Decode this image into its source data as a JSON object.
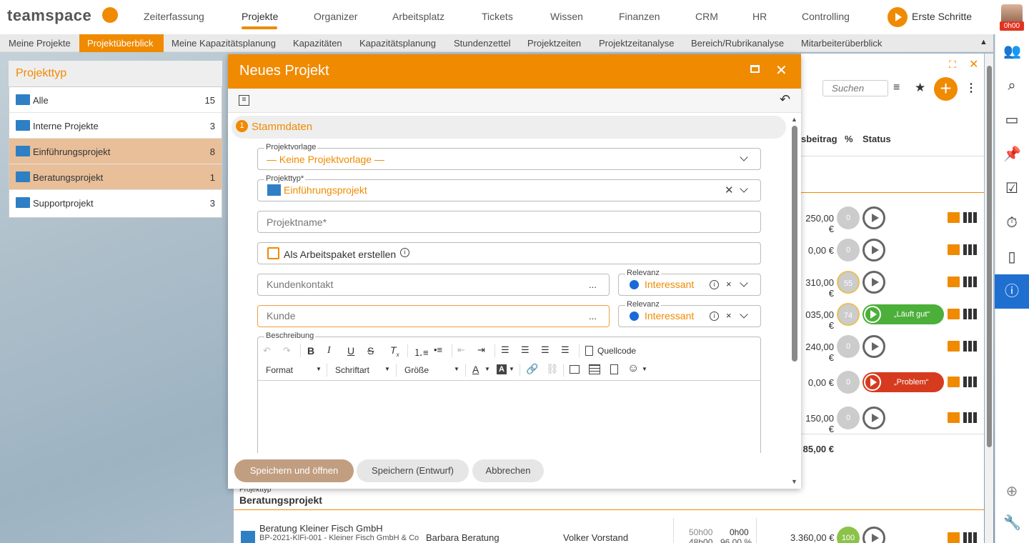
{
  "app": {
    "logo": "teamspace",
    "timer": "0h00",
    "erste": "Erste Schritte"
  },
  "nav": [
    "Zeiterfassung",
    "Projekte",
    "Organizer",
    "Arbeitsplatz",
    "Tickets",
    "Wissen",
    "Finanzen",
    "CRM",
    "HR",
    "Controlling"
  ],
  "subnav": [
    "Meine Projekte",
    "Projektüberblick",
    "Meine Kapazitätsplanung",
    "Kapazitäten",
    "Kapazitätsplanung",
    "Stundenzettel",
    "Projektzeiten",
    "Projektzeitanalyse",
    "Bereich/Rubrikanalyse",
    "Mitarbeiterüberblick"
  ],
  "left": {
    "title": "Projekttyp",
    "items": [
      {
        "label": "Alle",
        "count": "15"
      },
      {
        "label": "Interne Projekte",
        "count": "3"
      },
      {
        "label": "Einführungsprojekt",
        "count": "8"
      },
      {
        "label": "Beratungsprojekt",
        "count": "1"
      },
      {
        "label": "Supportprojekt",
        "count": "3"
      }
    ]
  },
  "bg": {
    "search_placeholder": "Suchen",
    "col_beitrag": "sbeitrag",
    "col_pct": "%",
    "col_status": "Status",
    "rows": [
      {
        "amount": "250,00 €",
        "score": "0"
      },
      {
        "amount": "0,00 €",
        "score": "0"
      },
      {
        "amount": "310,00 €",
        "score": "55"
      },
      {
        "amount": "035,00 €",
        "score": "74",
        "pill": "„Läuft gut“"
      },
      {
        "amount": "240,00 €",
        "score": "0"
      },
      {
        "amount": "0,00 €",
        "score": "0",
        "pill": "„Problem“"
      },
      {
        "amount": "150,00 €",
        "score": "0"
      }
    ],
    "total": "85,00 €",
    "group_label": "Projekttyp",
    "group_value": "Beratungsprojekt",
    "last_row": {
      "name": "Beratung Kleiner Fisch GmbH",
      "sub": "BP-2021-KlFi-001 - Kleiner Fisch GmbH & Co",
      "person1": "Barbara Beratung",
      "person2": "Volker Vorstand",
      "h1": "50h00",
      "h2": "0h00",
      "h3": "48h00",
      "h4": "96,00 %",
      "amount": "3.360,00 €",
      "score": "100"
    }
  },
  "modal": {
    "title": "Neues Projekt",
    "section": "Stammdaten",
    "section_num": "1",
    "vorlage_label": "Projektvorlage",
    "vorlage_value": "— Keine Projektvorlage —",
    "typ_label": "Projekttyp*",
    "typ_value": "Einführungsprojekt",
    "name_placeholder": "Projektname*",
    "arbeitspaket": "Als Arbeitspaket erstellen",
    "kontakt_placeholder": "Kundenkontakt",
    "kunde_placeholder": "Kunde",
    "dots": "...",
    "relevanz_label": "Relevanz",
    "relevanz_value": "Interessant",
    "beschreibung_label": "Beschreibung",
    "editor": {
      "quellcode": "Quellcode",
      "format": "Format",
      "schriftart": "Schriftart",
      "groesse": "Größe"
    },
    "buttons": {
      "save_open": "Speichern und öffnen",
      "save_draft": "Speichern (Entwurf)",
      "cancel": "Abbrechen"
    }
  },
  "colors": {
    "accent": "#f08a00",
    "active_blue": "#1f6fd1",
    "selected_row": "#e8bf99"
  }
}
